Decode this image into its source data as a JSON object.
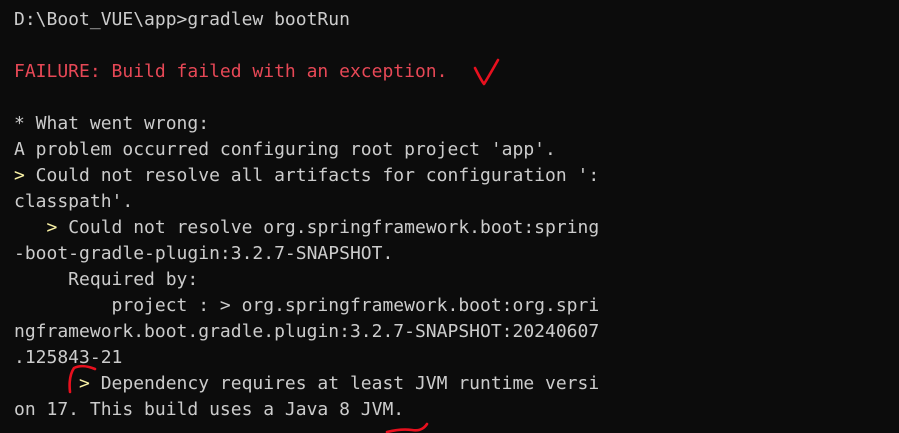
{
  "terminal": {
    "lines": [
      {
        "prefix": "",
        "text": "D:\\Boot_VUE\\app>gradlew bootRun"
      },
      {
        "prefix": "",
        "text": ""
      },
      {
        "prefix": "",
        "text": "FAILURE: Build failed with an exception."
      },
      {
        "prefix": "",
        "text": ""
      },
      {
        "prefix": "",
        "text": "* What went wrong:"
      },
      {
        "prefix": "",
        "text": "A problem occurred configuring root project 'app'."
      },
      {
        "prefix": ">",
        "text": " Could not resolve all artifacts for configuration ':"
      },
      {
        "prefix": "",
        "text": "classpath'."
      },
      {
        "prefix": "   >",
        "text": " Could not resolve org.springframework.boot:spring"
      },
      {
        "prefix": "",
        "text": "-boot-gradle-plugin:3.2.7-SNAPSHOT."
      },
      {
        "prefix": "",
        "text": "     Required by:"
      },
      {
        "prefix": "",
        "text": "         project : > org.springframework.boot:org.spri"
      },
      {
        "prefix": "",
        "text": "ngframework.boot.gradle.plugin:3.2.7-SNAPSHOT:20240607"
      },
      {
        "prefix": "",
        "text": ".125843-21"
      },
      {
        "prefix": "      >",
        "text": " Dependency requires at least JVM runtime versi"
      },
      {
        "prefix": "",
        "text": "on 17. This build uses a Java 8 JVM."
      }
    ]
  },
  "colors": {
    "background": "#0c0c0c",
    "text": "#cccccc",
    "error": "#e74856",
    "prompt_marker": "#f9f1a5",
    "annotation": "#e8101e"
  }
}
